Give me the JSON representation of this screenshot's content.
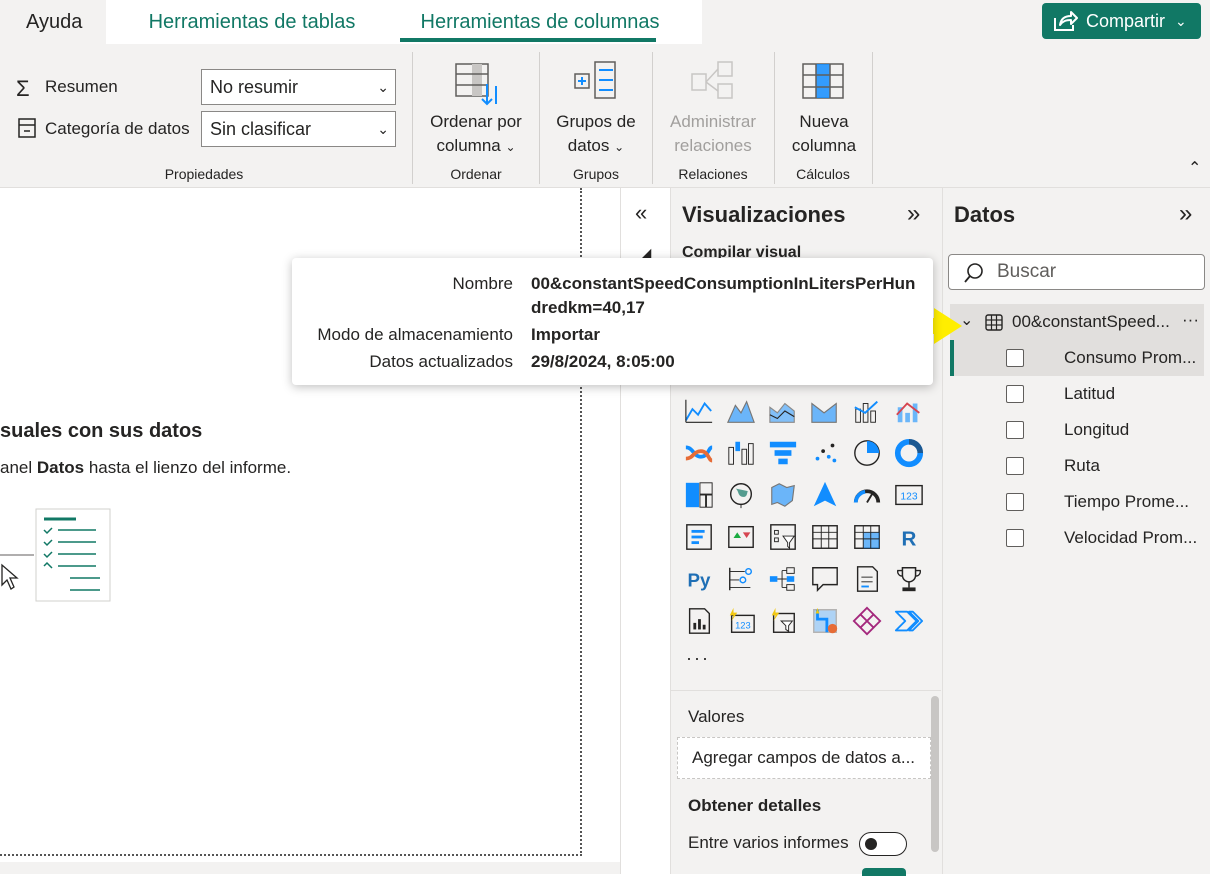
{
  "tabs": [
    {
      "label": "Ayuda"
    },
    {
      "label": "Herramientas de tablas"
    },
    {
      "label": "Herramientas de columnas"
    }
  ],
  "share_label": "Compartir",
  "ribbon": {
    "summary_label": "Resumen",
    "summary_value": "No resumir",
    "category_label": "Categoría de datos",
    "category_value": "Sin clasificar",
    "sort_line1": "Ordenar por",
    "sort_line2": "columna",
    "groups_line1": "Grupos de",
    "groups_line2": "datos",
    "relations_line1": "Administrar",
    "relations_line2": "relaciones",
    "newcol_line1": "Nueva",
    "newcol_line2": "columna",
    "group_labels": [
      "Propiedades",
      "Ordenar",
      "Grupos",
      "Relaciones",
      "Cálculos"
    ]
  },
  "canvas": {
    "heading": "suales con sus datos",
    "sub_prefix": "anel ",
    "sub_bold": "Datos",
    "sub_suffix": " hasta el lienzo del informe."
  },
  "viz": {
    "title": "Visualizaciones",
    "build_label": "Compilar visual",
    "more": "···",
    "values_label": "Valores",
    "values_placeholder": "Agregar campos de datos a...",
    "details_label": "Obtener detalles",
    "cross_report_label": "Entre varios informes",
    "cross_report_state": "off"
  },
  "datos": {
    "title": "Datos",
    "search_placeholder": "Buscar",
    "table_name": "00&constantSpeed...",
    "table_menu": "···",
    "fields": [
      "Consumo Prom...",
      "Latitud",
      "Longitud",
      "Ruta",
      "Tiempo Prome...",
      "Velocidad Prom..."
    ]
  },
  "tooltip": {
    "name_label": "Nombre",
    "name_line1": "00&constantSpeedConsumptionInLitersPerHun",
    "name_line2": "dredkm=40,17",
    "storage_label": "Modo de almacenamiento",
    "storage_value": "Importar",
    "updated_label": "Datos actualizados",
    "updated_value": "29/8/2024, 8:05:00"
  },
  "colors": {
    "accent": "#117865",
    "arrow": "#ffee00",
    "icon_blue": "#118dff"
  }
}
